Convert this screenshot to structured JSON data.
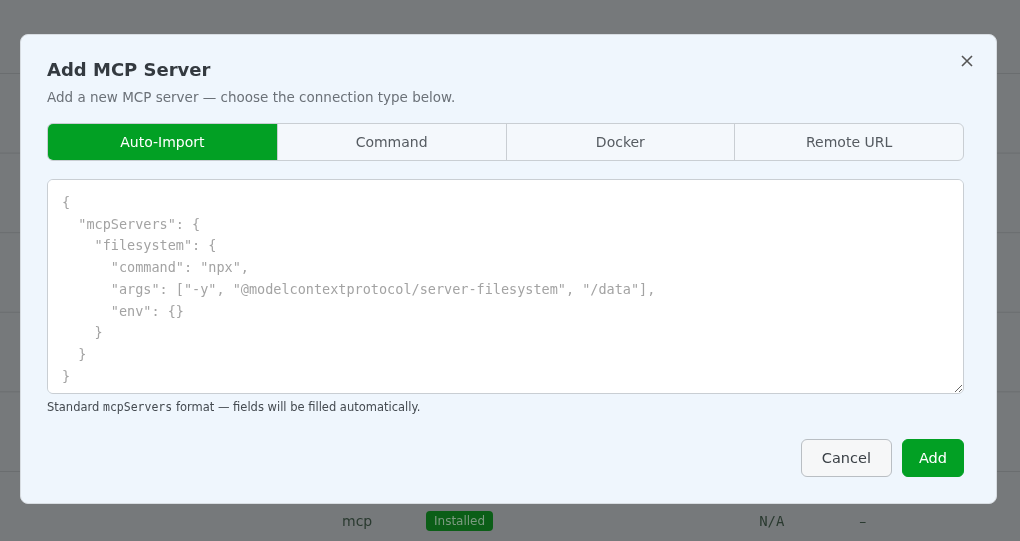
{
  "background": {
    "row": {
      "name": "mcp",
      "status": "Installed",
      "size": "N/A",
      "column_4": "–"
    }
  },
  "dialog": {
    "title": "Add MCP Server",
    "subtitle": "Add a new MCP server — choose the connection type below.",
    "tabs": [
      {
        "label": "Auto-Import",
        "selected": true
      },
      {
        "label": "Command",
        "selected": false
      },
      {
        "label": "Docker",
        "selected": false
      },
      {
        "label": "Remote URL",
        "selected": false
      }
    ],
    "editor": {
      "placeholder": "{\n  \"mcpServers\": {\n    \"filesystem\": {\n      \"command\": \"npx\",\n      \"args\": [\"-y\", \"@modelcontextprotocol/server-filesystem\", \"/data\"],\n      \"env\": {}\n    }\n  }\n}"
    },
    "hint": {
      "before": "Standard ",
      "code": "mcpServers",
      "after": " format — fields will be filled automatically."
    },
    "buttons": [
      {
        "label": "Cancel",
        "kind": "secondary"
      },
      {
        "label": "Add",
        "kind": "primary"
      }
    ]
  }
}
